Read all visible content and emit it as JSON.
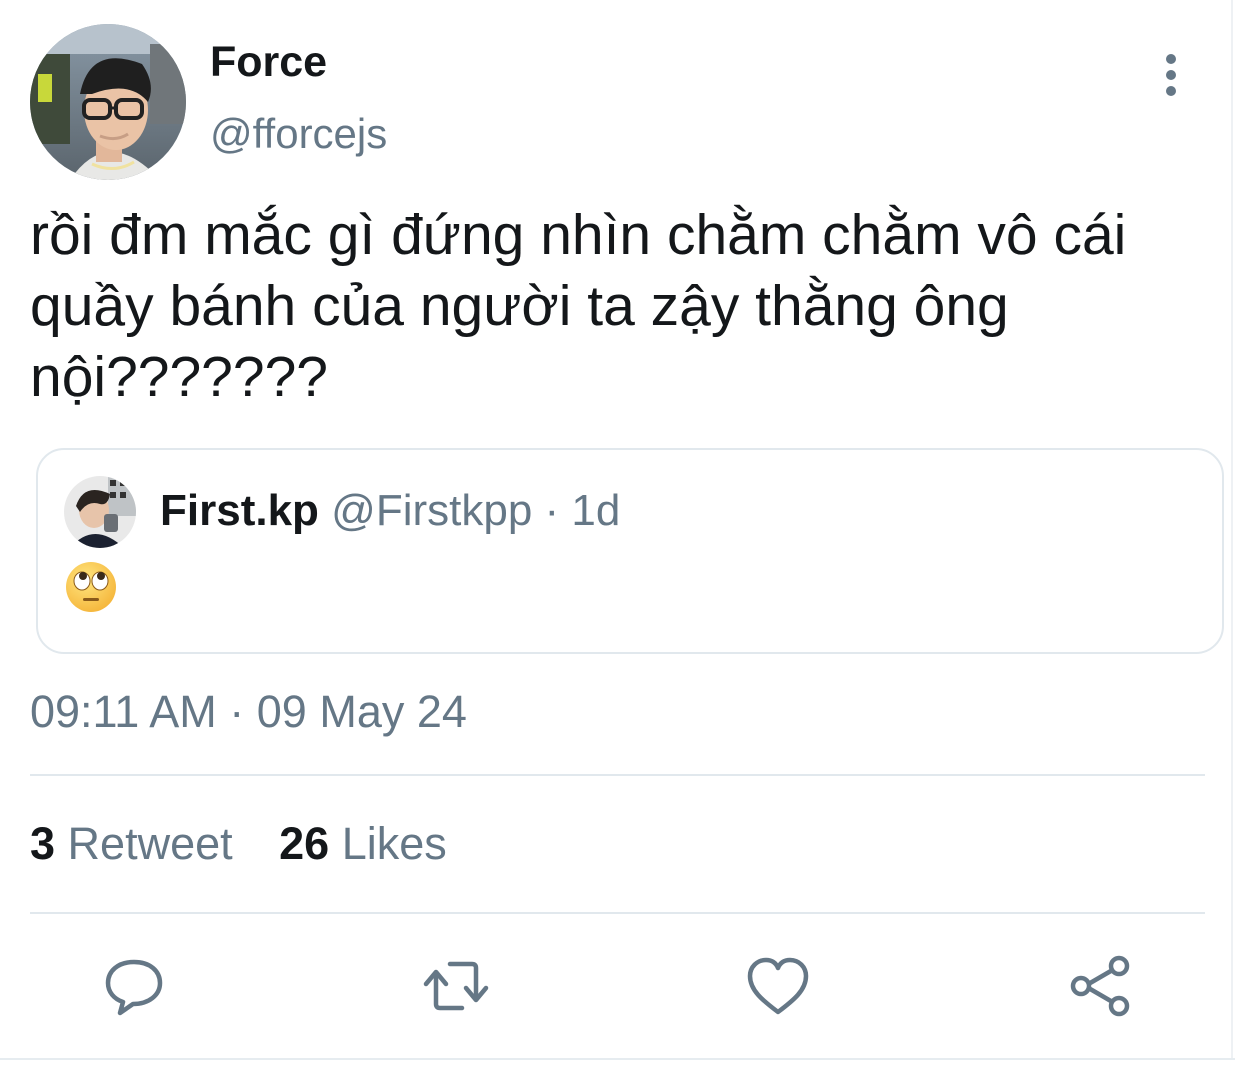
{
  "author": {
    "display_name": "Force",
    "handle": "@fforcejs",
    "avatar_icon": "profile-photo"
  },
  "tweet": {
    "text": "rồi đm mắc gì đứng nhìn chằm chằm vô cái\nquầy bánh của người ta zậy thằng ông\nnội???????"
  },
  "quoted_tweet": {
    "display_name": "First.kp",
    "handle": "@Firstkpp",
    "separator": "·",
    "age": "1d",
    "content_icon": "face-with-rolling-eyes-emoji"
  },
  "timestamp": "09:11 AM · 09 May 24",
  "stats": {
    "retweet_count": "3",
    "retweet_label": "Retweet",
    "likes_count": "26",
    "likes_label": "Likes"
  },
  "actions": [
    "reply-icon",
    "retweet-icon",
    "like-icon",
    "share-icon"
  ],
  "colors": {
    "text_primary": "#14171a",
    "text_secondary": "#657786",
    "border": "#e1e8ed",
    "icon": "#657786"
  }
}
